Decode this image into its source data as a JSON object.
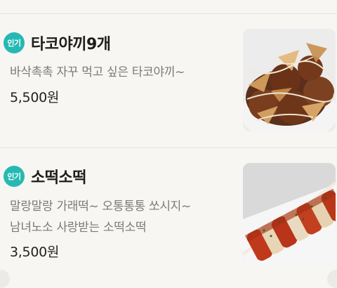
{
  "menu_items": [
    {
      "badge": "인기",
      "name": "타코야끼9개",
      "description_lines": [
        "바삭촉촉 자꾸 먹고 싶은 타코야끼~"
      ],
      "price": "5,500원",
      "image": "takoyaki-photo"
    },
    {
      "badge": "인기",
      "name": "소떡소떡",
      "description_lines": [
        "말랑말랑 가래떡~ 오통통통 쏘시지~",
        "남녀노소 사랑받는 소떡소떡"
      ],
      "price": "3,500원",
      "image": "sotteok-photo"
    }
  ],
  "colors": {
    "badge": "#26b9b3",
    "background": "#f7f6f3",
    "divider": "#e4e2dd"
  }
}
